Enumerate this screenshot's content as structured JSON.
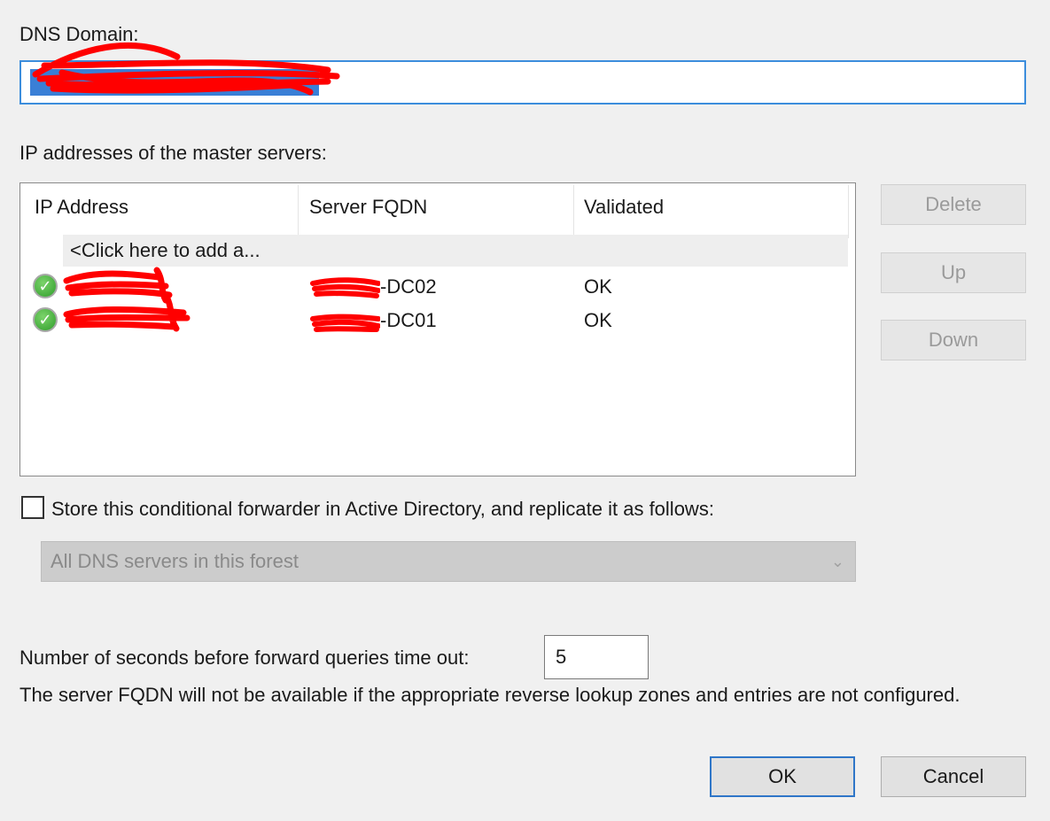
{
  "dns_domain": {
    "label": "DNS Domain:",
    "value": ""
  },
  "master_servers": {
    "label": "IP addresses of the master servers:",
    "columns": [
      "IP Address",
      "Server FQDN",
      "Validated"
    ],
    "add_row_text": "<Click here to add a...",
    "rows": [
      {
        "ip": "",
        "fqdn_suffix": "-DC02",
        "validated": "OK"
      },
      {
        "ip": "",
        "fqdn_suffix": "-DC01",
        "validated": "OK"
      }
    ]
  },
  "side_buttons": {
    "delete": "Delete",
    "up": "Up",
    "down": "Down"
  },
  "store_ad": {
    "label": "Store this conditional forwarder in Active Directory, and replicate it as follows:",
    "checked": false
  },
  "replication_scope": {
    "selected": "All DNS servers in this forest"
  },
  "timeout": {
    "label": "Number of seconds before forward queries time out:",
    "value": "5"
  },
  "note": "The server FQDN will not be available if the appropriate reverse lookup zones and entries are not configured.",
  "buttons": {
    "ok": "OK",
    "cancel": "Cancel"
  },
  "colors": {
    "background": "#f0f0f0",
    "focus_border": "#3c8ddc",
    "selection": "#3a7fd6",
    "redaction": "#ff0000",
    "validated_icon": "#2f9d2a"
  }
}
